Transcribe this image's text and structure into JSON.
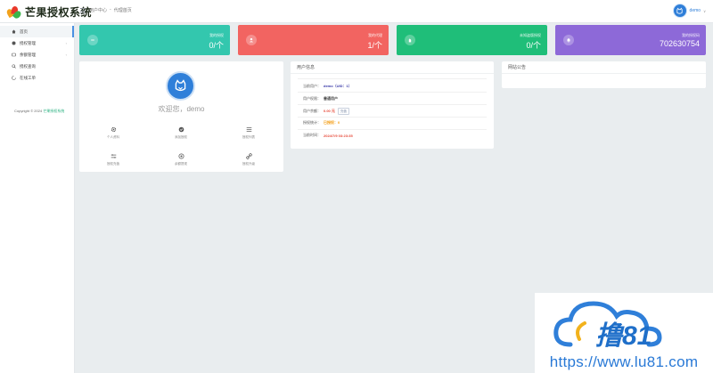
{
  "app": {
    "title": "芒果授权系统"
  },
  "header": {
    "breadcrumb": [
      "用户中心",
      "-",
      "代理首页"
    ],
    "user_name": "demo",
    "user_caret": "∨"
  },
  "sidebar": {
    "items": [
      {
        "label": "首页",
        "icon": "home-icon"
      },
      {
        "label": "授权管理",
        "icon": "shield-icon",
        "arrow": "‹"
      },
      {
        "label": "余额管理",
        "icon": "wallet-icon",
        "arrow": "‹"
      },
      {
        "label": "授权查询",
        "icon": "search-icon"
      },
      {
        "label": "在线工单",
        "icon": "ticket-icon"
      }
    ],
    "copyright_prefix": "Copyright © 2024",
    "copyright_link": "芒果授权系统"
  },
  "stats": [
    {
      "label": "我的授权",
      "value": "0/个",
      "color": "#33c7ae",
      "icon": "minus-icon"
    },
    {
      "label": "我的代理",
      "value": "1/个",
      "color": "#f26461",
      "icon": "user-icon"
    },
    {
      "label": "未知盗版授权",
      "value": "0/个",
      "color": "#1fbe79",
      "icon": "hand-icon"
    },
    {
      "label": "我的授权码",
      "value": "702630754",
      "color": "#8d69d8",
      "icon": "bell-icon"
    }
  ],
  "welcome": {
    "greeting": "欢迎您，demo",
    "actions": [
      {
        "label": "个人资料",
        "icon": "gear-icon"
      },
      {
        "label": "添加授权",
        "icon": "check-shield-icon"
      },
      {
        "label": "授权列表",
        "icon": "list-icon"
      },
      {
        "label": "授权充值",
        "icon": "recharge-icon"
      },
      {
        "label": "余额提现",
        "icon": "coin-icon"
      },
      {
        "label": "授权升级",
        "icon": "link-icon"
      }
    ]
  },
  "account": {
    "title": "用户信息",
    "rows": [
      {
        "key": "当前用户：",
        "value": "demo（UID：1）",
        "color": "#3a3aa8"
      },
      {
        "key": "用户权限：",
        "value": "普通用户",
        "color": "#444444"
      },
      {
        "key": "用户余额：",
        "value": "0.00 元",
        "color": "#e74c3c",
        "badge": "充值",
        "badge_color": "#7a8aa6"
      },
      {
        "key": "授权统计：",
        "value": "已授权：0",
        "color": "#f39c12"
      },
      {
        "key": "当前时间：",
        "value": "2024/7/9 03:23:35",
        "color": "#e74c3c"
      }
    ]
  },
  "notice": {
    "title": "网站公告"
  },
  "watermark": {
    "url": "https://www.lu81.com",
    "brand": "撸81"
  }
}
